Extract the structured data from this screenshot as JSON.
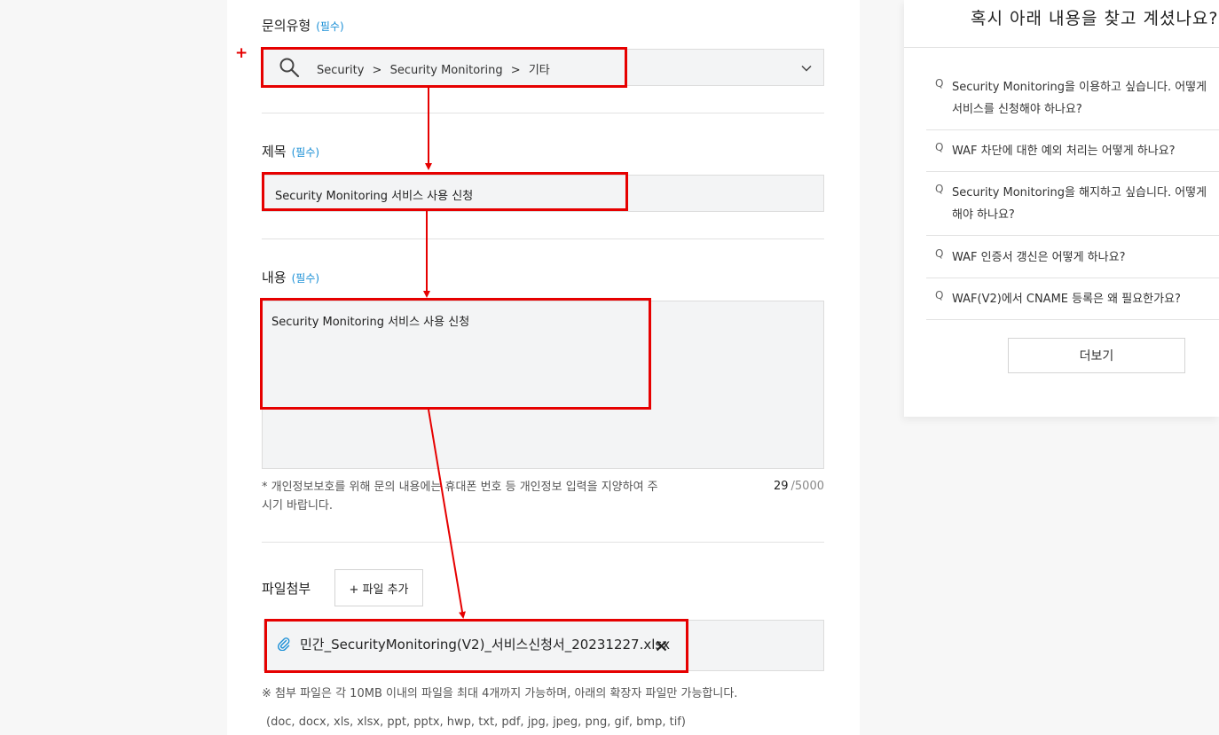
{
  "form": {
    "inquiry_type": {
      "label": "문의유형",
      "required": "(필수)",
      "path": [
        "Security",
        "Security Monitoring",
        "기타"
      ],
      "separator": ">"
    },
    "title": {
      "label": "제목",
      "required": "(필수)",
      "value": "Security Monitoring 서비스 사용 신청"
    },
    "content": {
      "label": "내용",
      "required": "(필수)",
      "value": "Security Monitoring 서비스 사용 신청",
      "privacy_note_line1": "* 개인정보보호를 위해 문의 내용에는 휴대폰 번호 등 개인정보 입력을 지양하여 주",
      "privacy_note_line2": "시기 바랍니다.",
      "char_count": "29",
      "char_max": "/5000"
    },
    "attachment": {
      "label": "파일첨부",
      "add_button": "+ 파일 추가",
      "file_name": "민간_SecurityMonitoring(V2)_서비스신청서_20231227.xlsx",
      "note": "※ 첨부 파일은 각 10MB 이내의 파일을 최대 4개까지 가능하며, 아래의 확장자 파일만 가능합니다.",
      "extensions": "(doc, docx, xls, xlsx, ppt, pptx, hwp, txt, pdf, jpg, jpeg, png, gif, bmp, tif)"
    },
    "annotation_marker": "+"
  },
  "faq": {
    "title": "혹시 아래 내용을 찾고 계셨나요?",
    "q_marker": "Q",
    "items": [
      {
        "line1": "Security Monitoring을 이용하고 싶습니다. 어떻게",
        "line2": "서비스를 신청해야 하나요?"
      },
      {
        "line1": "WAF 차단에 대한 예외 처리는 어떻게 하나요?"
      },
      {
        "line1": "Security Monitoring을 해지하고 싶습니다. 어떻게",
        "line2": "해야 하나요?"
      },
      {
        "line1": "WAF 인증서 갱신은 어떻게 하나요?"
      },
      {
        "line1": "WAF(V2)에서 CNAME 등록은 왜 필요한가요?"
      }
    ],
    "more_button": "더보기"
  },
  "colors": {
    "accent": "#1a8fd6",
    "annotation_red": "#e60000",
    "field_bg": "#f3f4f5"
  }
}
